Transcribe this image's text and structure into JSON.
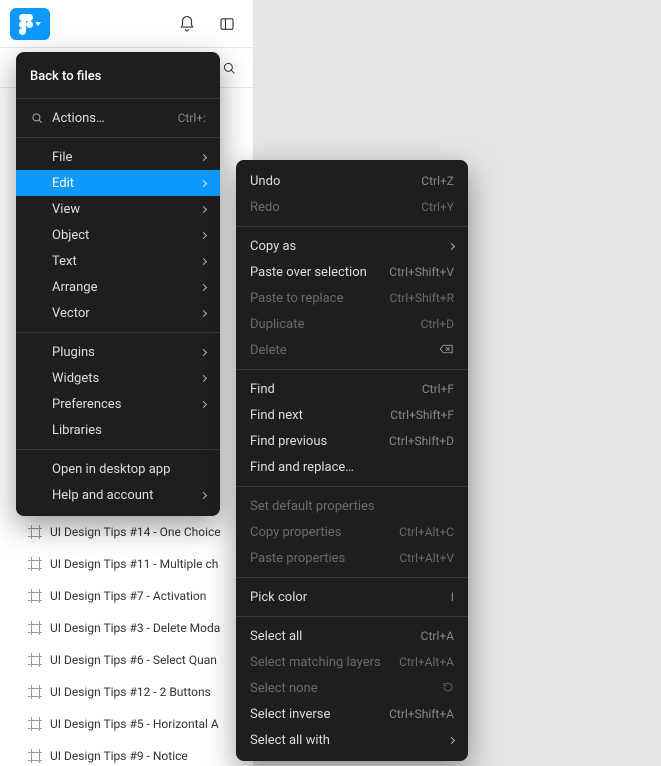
{
  "colors": {
    "accent": "#0d99ff"
  },
  "topbar": {
    "logo": "figma-logo"
  },
  "panel_tabs": {
    "search_placeholder": "Search"
  },
  "layers": [
    {
      "name": "UI Design Tips #14 - One Choice"
    },
    {
      "name": "UI Design Tips #11 - Multiple ch"
    },
    {
      "name": "UI Design Tips #7 - Activation"
    },
    {
      "name": "UI Design Tips #3 - Delete Moda"
    },
    {
      "name": "UI Design Tips #6 - Select Quan"
    },
    {
      "name": "UI Design Tips #12 - 2 Buttons"
    },
    {
      "name": "UI Design Tips #5 - Horizontal A"
    },
    {
      "name": "UI Design Tips #9 - Notice"
    }
  ],
  "menu": {
    "back": "Back to files",
    "actions": {
      "label": "Actions…",
      "shortcut": "Ctrl+:"
    },
    "groups": [
      [
        {
          "label": "File",
          "submenu": true
        },
        {
          "label": "Edit",
          "submenu": true,
          "highlight": true
        },
        {
          "label": "View",
          "submenu": true
        },
        {
          "label": "Object",
          "submenu": true
        },
        {
          "label": "Text",
          "submenu": true
        },
        {
          "label": "Arrange",
          "submenu": true
        },
        {
          "label": "Vector",
          "submenu": true
        }
      ],
      [
        {
          "label": "Plugins",
          "submenu": true
        },
        {
          "label": "Widgets",
          "submenu": true
        },
        {
          "label": "Preferences",
          "submenu": true
        },
        {
          "label": "Libraries"
        }
      ],
      [
        {
          "label": "Open in desktop app"
        },
        {
          "label": "Help and account",
          "submenu": true
        }
      ]
    ]
  },
  "edit_menu": {
    "sections": [
      [
        {
          "label": "Undo",
          "shortcut": "Ctrl+Z"
        },
        {
          "label": "Redo",
          "shortcut": "Ctrl+Y",
          "disabled": true
        }
      ],
      [
        {
          "label": "Copy as",
          "submenu": true
        },
        {
          "label": "Paste over selection",
          "shortcut": "Ctrl+Shift+V"
        },
        {
          "label": "Paste to replace",
          "shortcut": "Ctrl+Shift+R",
          "disabled": true
        },
        {
          "label": "Duplicate",
          "shortcut": "Ctrl+D",
          "disabled": true
        },
        {
          "label": "Delete",
          "trailing_icon": "backspace",
          "disabled": true
        }
      ],
      [
        {
          "label": "Find",
          "shortcut": "Ctrl+F"
        },
        {
          "label": "Find next",
          "shortcut": "Ctrl+Shift+F"
        },
        {
          "label": "Find previous",
          "shortcut": "Ctrl+Shift+D"
        },
        {
          "label": "Find and replace…"
        }
      ],
      [
        {
          "label": "Set default properties",
          "disabled": true
        },
        {
          "label": "Copy properties",
          "shortcut": "Ctrl+Alt+C",
          "disabled": true
        },
        {
          "label": "Paste properties",
          "shortcut": "Ctrl+Alt+V",
          "disabled": true
        }
      ],
      [
        {
          "label": "Pick color",
          "shortcut": "I"
        }
      ],
      [
        {
          "label": "Select all",
          "shortcut": "Ctrl+A"
        },
        {
          "label": "Select matching layers",
          "shortcut": "Ctrl+Alt+A",
          "disabled": true
        },
        {
          "label": "Select none",
          "trailing_icon": "revert",
          "disabled": true
        },
        {
          "label": "Select inverse",
          "shortcut": "Ctrl+Shift+A"
        },
        {
          "label": "Select all with",
          "submenu": true
        }
      ]
    ]
  }
}
